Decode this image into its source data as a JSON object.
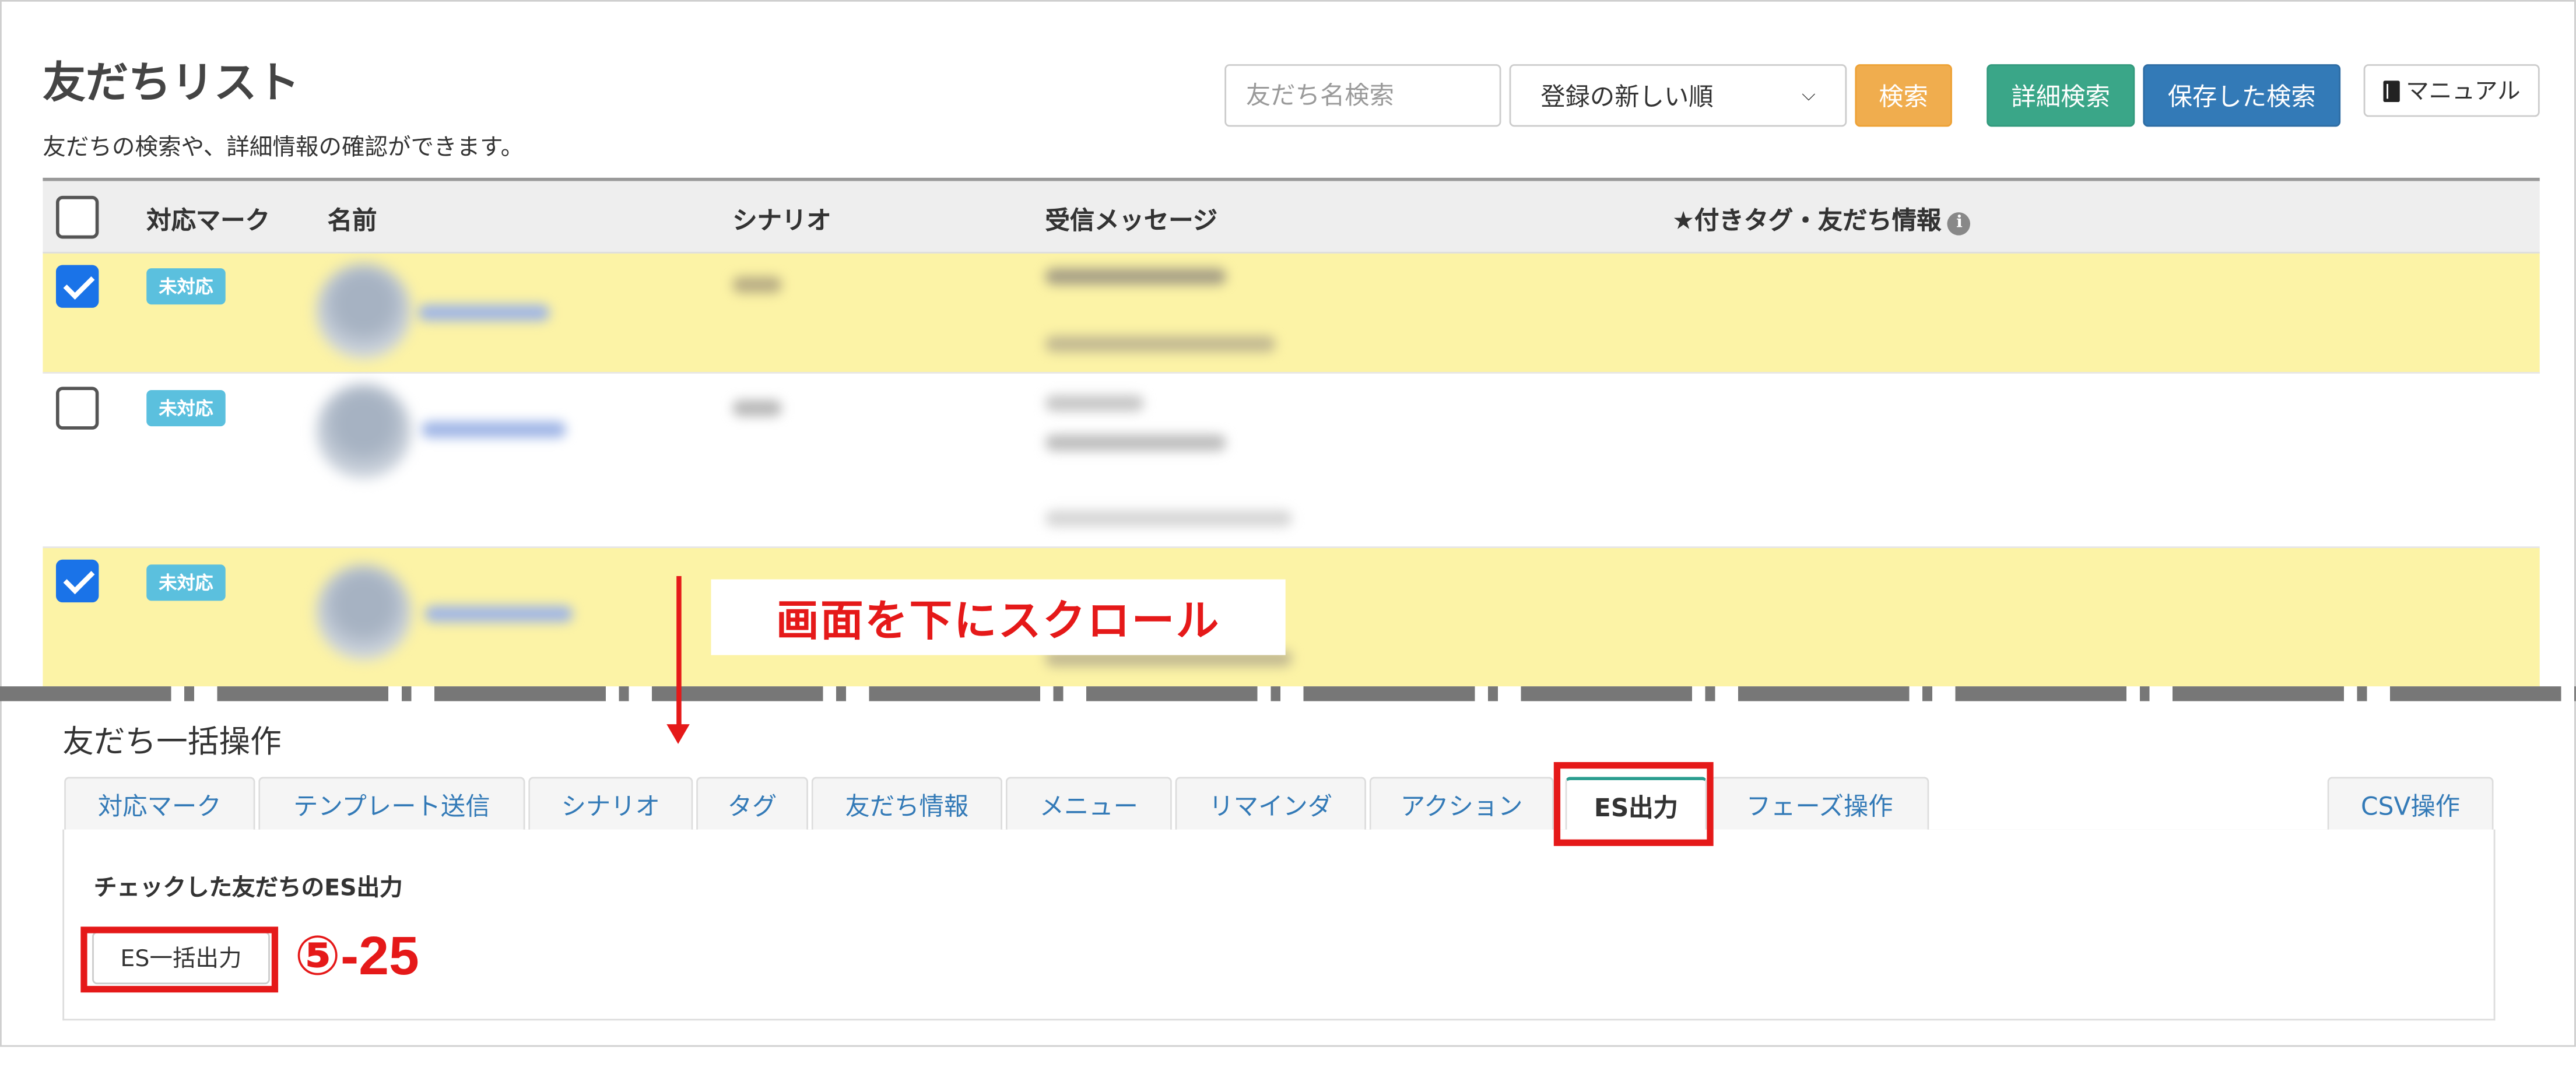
{
  "header": {
    "title": "友だちリスト",
    "subtitle": "友だちの検索や、詳細情報の確認ができます。",
    "search_placeholder": "友だち名検索",
    "sort_selected": "登録の新しい順",
    "search_button": "検索",
    "detail_search_button": "詳細検索",
    "saved_search_button": "保存した検索",
    "manual_button": "マニュアル"
  },
  "table": {
    "columns": [
      "対応マーク",
      "名前",
      "シナリオ",
      "受信メッセージ",
      "★付きタグ・友だち情報"
    ],
    "rows": [
      {
        "checked": true,
        "status": "未対応"
      },
      {
        "checked": false,
        "status": "未対応"
      },
      {
        "checked": true,
        "status": "未対応"
      }
    ]
  },
  "annotation": {
    "scroll_label": "画面を下にスクロール",
    "step_label": "⑤-25",
    "color": "#e51919"
  },
  "bulk": {
    "title": "友だち一括操作",
    "tabs": [
      "対応マーク",
      "テンプレート送信",
      "シナリオ",
      "タグ",
      "友だち情報",
      "メニュー",
      "リマインダ",
      "アクション",
      "ES出力",
      "フェーズ操作"
    ],
    "csv_tab": "CSV操作",
    "active_tab": "ES出力",
    "panel_heading": "チェックした友だちのES出力",
    "es_button": "ES一括出力"
  },
  "colors": {
    "row_checked": "#fcf3a6",
    "badge": "#5bc0de",
    "search_button": "#f0ad4e",
    "detail_button": "#3aa688",
    "saved_button": "#337ab7",
    "checkbox": "#1a73e8"
  }
}
